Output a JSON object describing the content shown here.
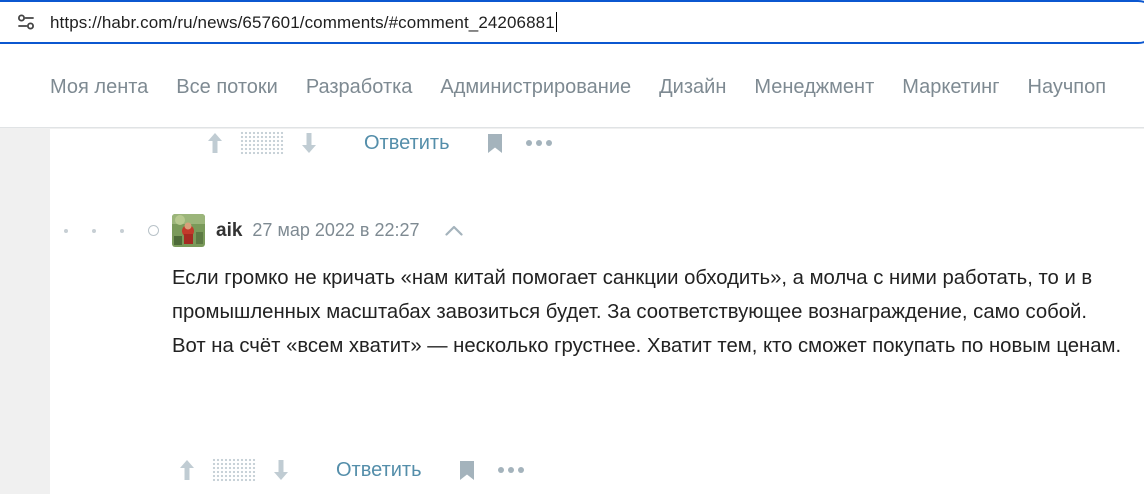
{
  "browser": {
    "url": "https://habr.com/ru/news/657601/comments/#comment_24206881"
  },
  "nav": {
    "items": [
      "Моя лента",
      "Все потоки",
      "Разработка",
      "Администрирование",
      "Дизайн",
      "Менеджмент",
      "Маркетинг",
      "Научпоп"
    ]
  },
  "top_actions": {
    "reply_label": "Ответить"
  },
  "comment": {
    "author": "aik",
    "date": "27 мар 2022 в 22:27",
    "paragraphs": [
      "Если громко не кричать «нам китай помогает санкции обходить», а молча с ними работать, то и в промышленных масштабах завозиться будет. За соответствующее вознаграждение, само собой.",
      "Вот на счёт «всем хватит» — несколько грустнее. Хватит тем, кто сможет покупать по новым ценам."
    ],
    "reply_label": "Ответить"
  },
  "colors": {
    "accent": "#548eaa",
    "address_border": "#0b57d0",
    "muted_text": "#7e8a92"
  }
}
